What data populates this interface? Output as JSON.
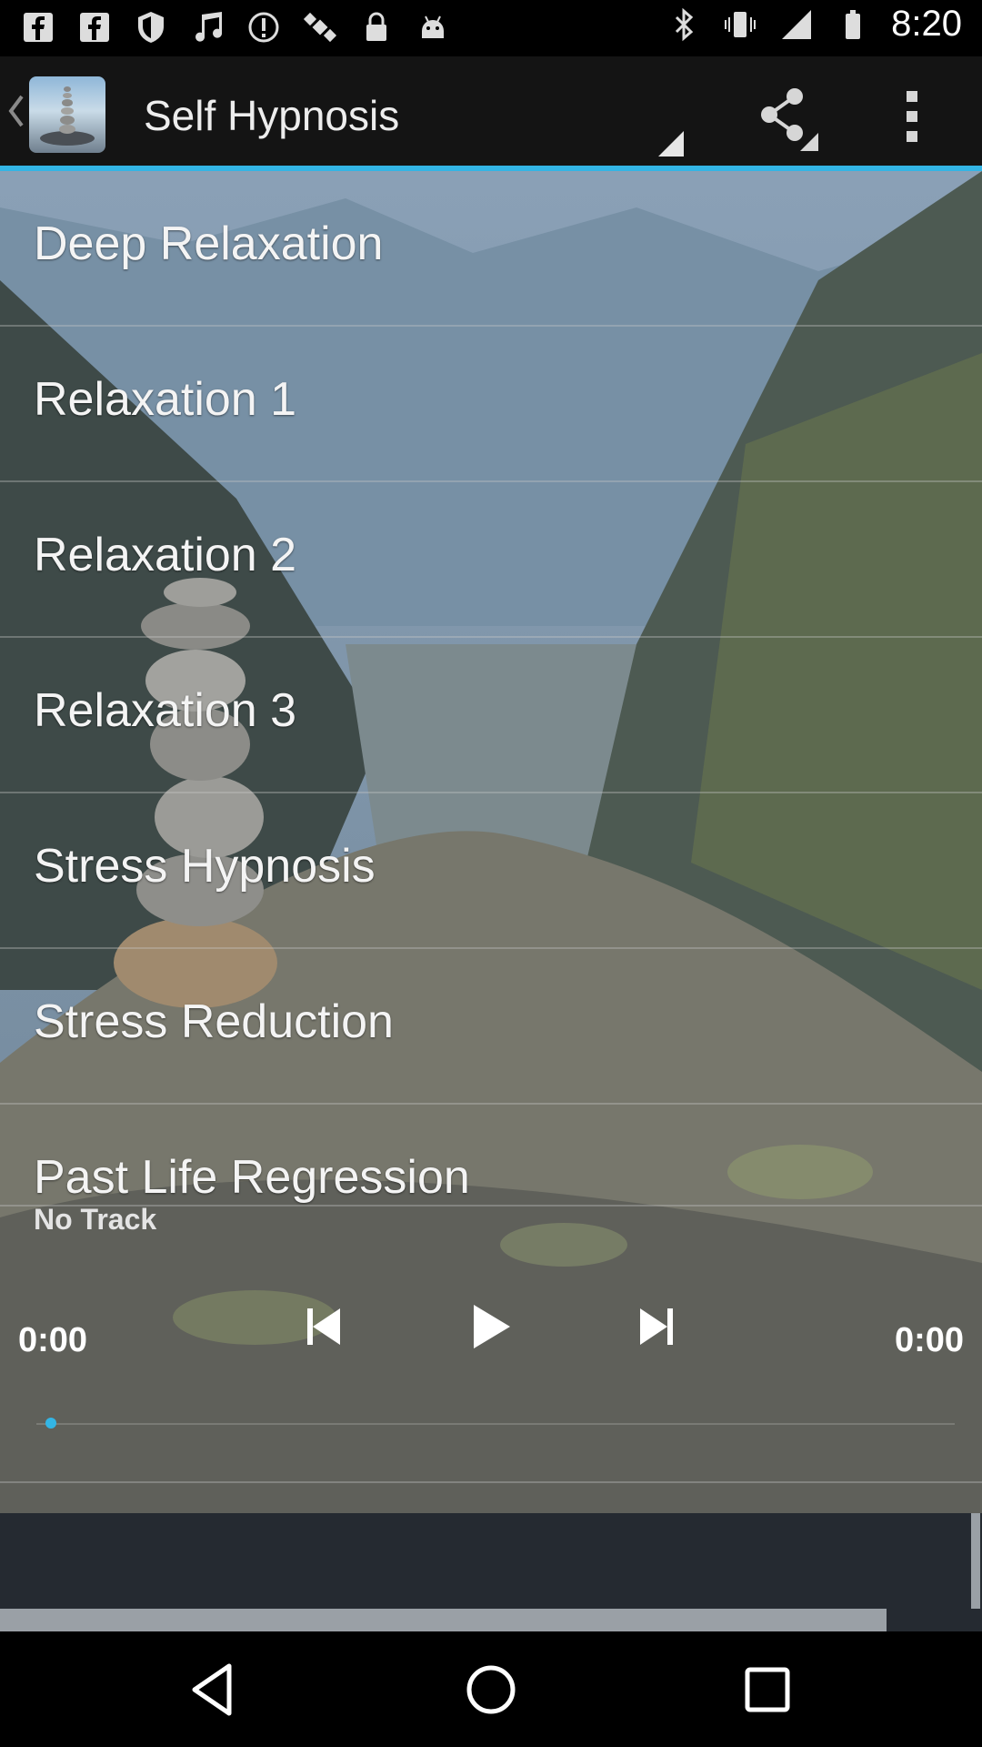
{
  "status_bar": {
    "time": "8:20",
    "left_icons": [
      "facebook-icon",
      "facebook-icon",
      "shield-icon",
      "music-icon",
      "notification-icon",
      "satellite-icon",
      "lock-icon",
      "android-icon"
    ],
    "right_icons": [
      "bluetooth-icon",
      "vibrate-icon",
      "signal-icon",
      "battery-icon"
    ]
  },
  "action_bar": {
    "title": "Self Hypnosis",
    "share_icon": "share-icon",
    "overflow_icon": "overflow-menu-icon"
  },
  "list": {
    "items": [
      {
        "label": "Deep Relaxation"
      },
      {
        "label": "Relaxation 1"
      },
      {
        "label": "Relaxation 2"
      },
      {
        "label": "Relaxation 3"
      },
      {
        "label": "Stress Hypnosis"
      },
      {
        "label": "Stress Reduction"
      },
      {
        "label": "Past Life Regression"
      }
    ]
  },
  "player": {
    "track": "No Track",
    "elapsed": "0:00",
    "duration": "0:00",
    "progress": 0
  },
  "colors": {
    "accent": "#33b5e5",
    "action_bar": "#141414",
    "footer": "#252a31"
  }
}
